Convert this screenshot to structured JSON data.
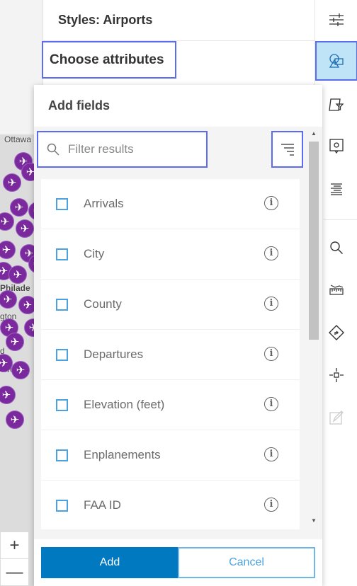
{
  "header": {
    "title": "Styles: Airports",
    "section": "Choose attributes"
  },
  "map": {
    "labels": [
      "Ottawa",
      "Philade",
      "gton",
      "d",
      "orfolk"
    ],
    "zoom_in": "+",
    "zoom_out": "—",
    "symbol_color": "#7b2a9e"
  },
  "popup": {
    "title": "Add fields",
    "search_placeholder": "Filter results",
    "fields": [
      {
        "label": "Arrivals",
        "checked": false
      },
      {
        "label": "City",
        "checked": false
      },
      {
        "label": "County",
        "checked": false
      },
      {
        "label": "Departures",
        "checked": false
      },
      {
        "label": "Elevation (feet)",
        "checked": false
      },
      {
        "label": "Enplanements",
        "checked": false
      },
      {
        "label": "FAA ID",
        "checked": false
      }
    ],
    "add_label": "Add",
    "cancel_label": "Cancel"
  },
  "toolbar": {
    "icons": [
      "properties-icon",
      "styles-icon",
      "filter-icon",
      "configure-popup-icon",
      "labels-icon",
      "search-icon",
      "measure-icon",
      "directions-icon",
      "locate-icon",
      "sketch-icon"
    ],
    "active": "styles-icon",
    "accent": "#0079c1"
  }
}
